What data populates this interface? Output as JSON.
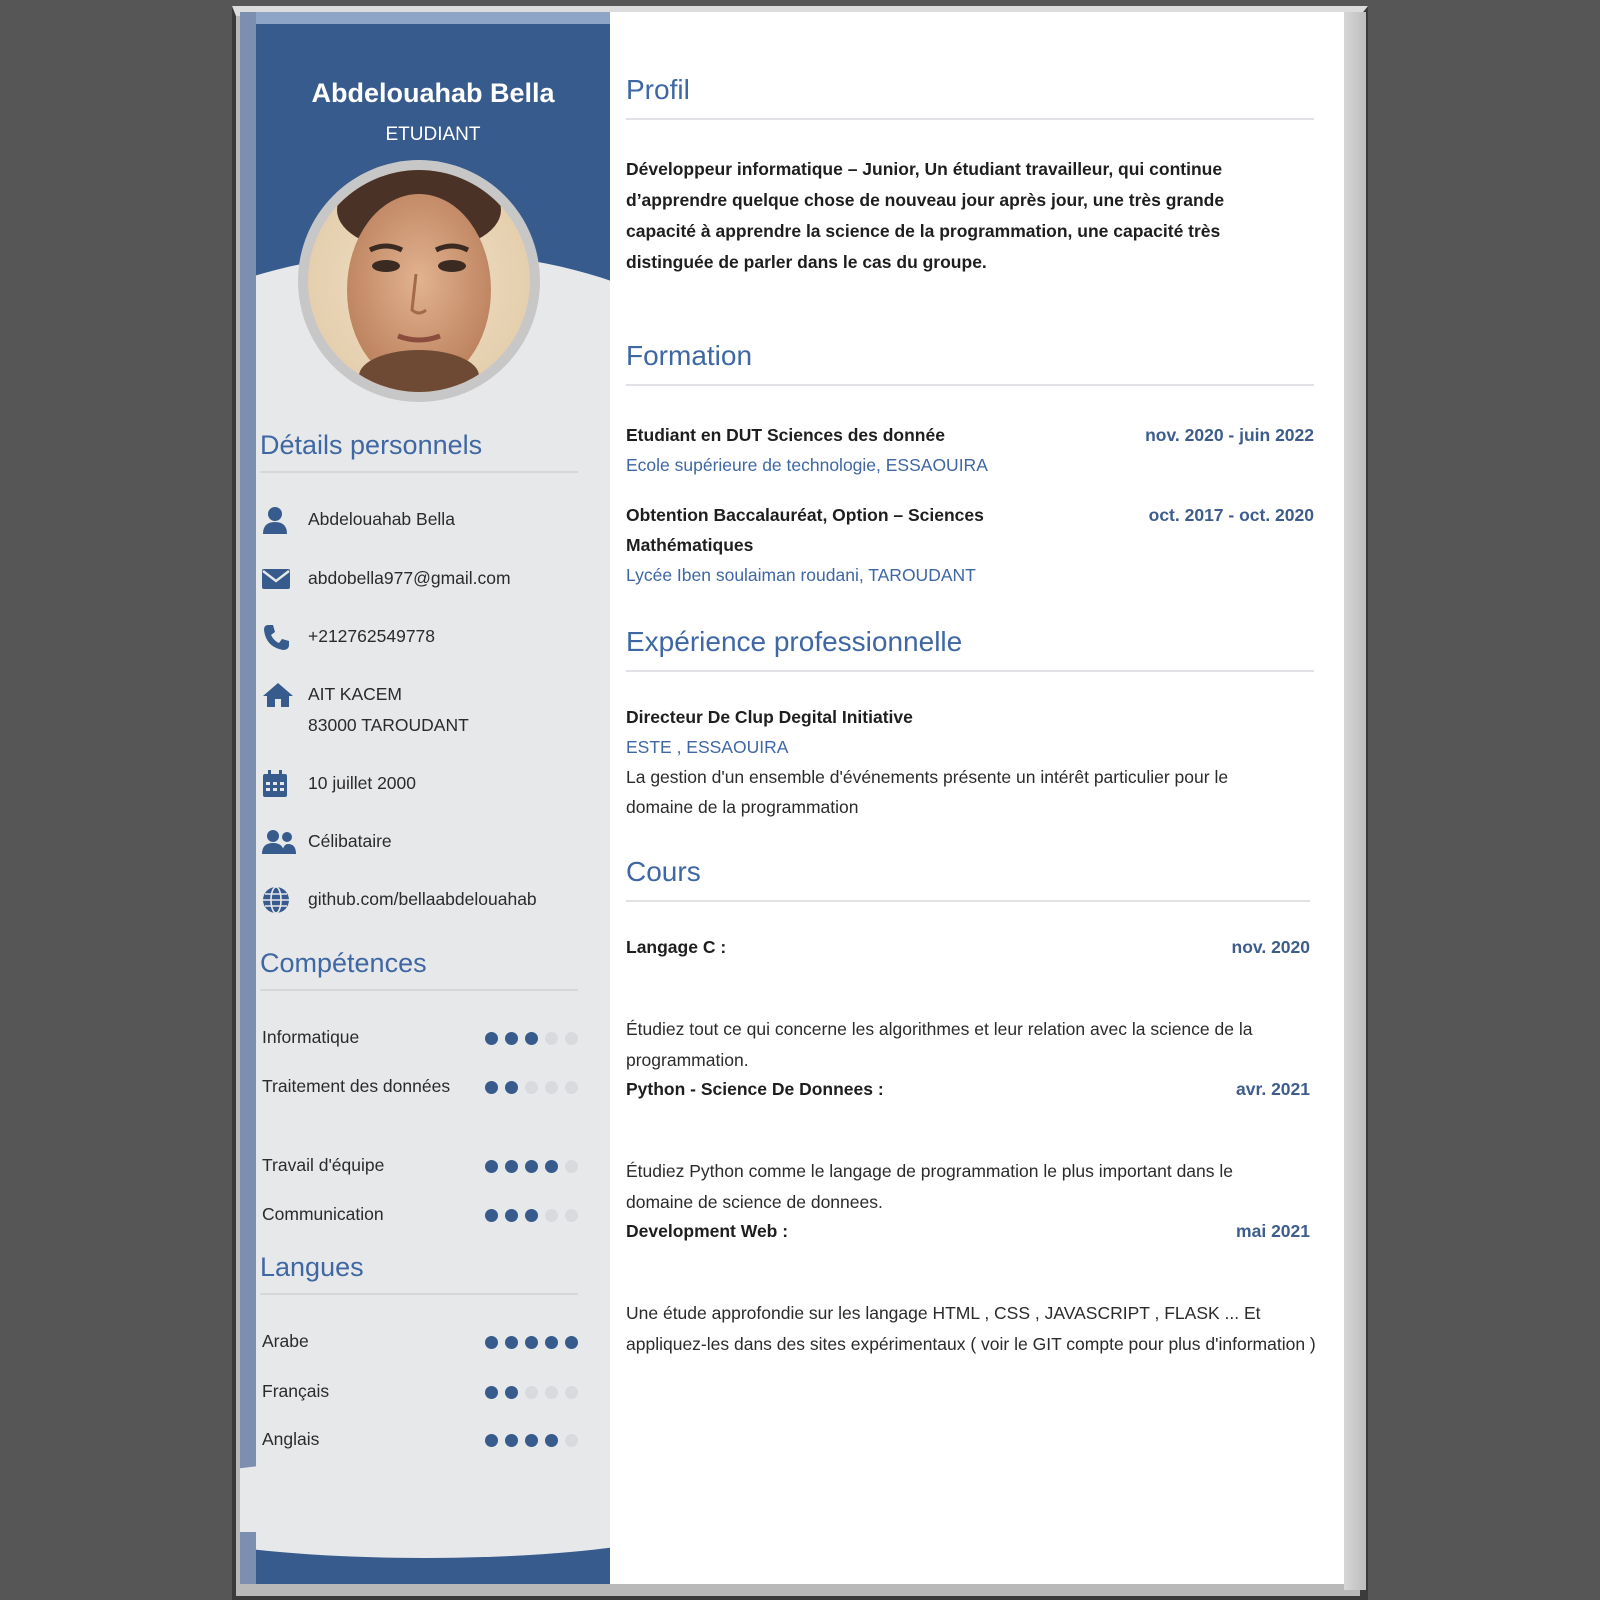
{
  "header": {
    "name": "Abdelouahab Bella",
    "role": "ETUDIANT"
  },
  "sidebar": {
    "details_title": "Détails personnels",
    "details": [
      {
        "icon": "user-icon",
        "text": "Abdelouahab Bella"
      },
      {
        "icon": "envelope-icon",
        "text": "abdobella977@gmail.com"
      },
      {
        "icon": "phone-icon",
        "text": "+212762549778"
      },
      {
        "icon": "home-icon",
        "text": "AIT KACEM\n83000  TAROUDANT"
      },
      {
        "icon": "calendar-icon",
        "text": "10 juillet 2000"
      },
      {
        "icon": "users-icon",
        "text": "Célibataire"
      },
      {
        "icon": "globe-icon",
        "text": "github.com/bellaabdelouahab"
      }
    ],
    "skills_title": "Compétences",
    "skills": [
      {
        "label": "Informatique",
        "level": 3,
        "max": 5
      },
      {
        "label": "Traitement des données",
        "level": 2,
        "max": 5
      },
      {
        "label": "Travail d'équipe",
        "level": 4,
        "max": 5
      },
      {
        "label": "Communication",
        "level": 3,
        "max": 5
      }
    ],
    "languages_title": "Langues",
    "languages": [
      {
        "label": "Arabe",
        "level": 5,
        "max": 5
      },
      {
        "label": "Français",
        "level": 2,
        "max": 5
      },
      {
        "label": "Anglais",
        "level": 4,
        "max": 5
      }
    ]
  },
  "main": {
    "profil_title": "Profil",
    "profil_text": "Développeur informatique – Junior,  Un étudiant travailleur, qui continue d’apprendre quelque chose de nouveau jour après jour, une très grande capacité à apprendre la science de la programmation, une capacité très distinguée de parler dans le cas du groupe.",
    "formation_title": "Formation",
    "formation": [
      {
        "title": "Etudiant en DUT Sciences des donnée",
        "date": "nov. 2020 - juin 2022",
        "place": "Ecole supérieure de technologie, ESSAOUIRA"
      },
      {
        "title": "Obtention Baccalauréat, Option – Sciences Mathématiques",
        "date": "oct. 2017 - oct. 2020",
        "place": "Lycée Iben soulaiman roudani, TAROUDANT"
      }
    ],
    "experience_title": "Expérience professionnelle",
    "experience": [
      {
        "title": "Directeur De Clup Degital Initiative",
        "place": "ESTE , ESSAOUIRA",
        "description": "La gestion d'un ensemble d'événements présente un intérêt particulier pour le domaine de la programmation"
      }
    ],
    "cours_title": "Cours",
    "cours": [
      {
        "title": "Langage C :",
        "date": "nov. 2020",
        "description": "Étudiez tout ce qui concerne les algorithmes et leur relation avec la science de la programmation."
      },
      {
        "title": "Python - Science De Donnees :",
        "date": "avr. 2021",
        "description": "Étudiez Python comme le langage de programmation le plus important dans le domaine de science de donnees."
      },
      {
        "title": "Development Web :",
        "date": "mai 2021",
        "description": "Une étude approfondie sur les langage HTML , CSS , JAVASCRIPT , FLASK ... Et appliquez-les dans des sites expérimentaux ( voir le GIT compte pour plus d'information )"
      }
    ]
  },
  "colors": {
    "accent": "#365b8c",
    "heading": "#3e67a3",
    "sidebar_bg": "#e7e8ea"
  }
}
